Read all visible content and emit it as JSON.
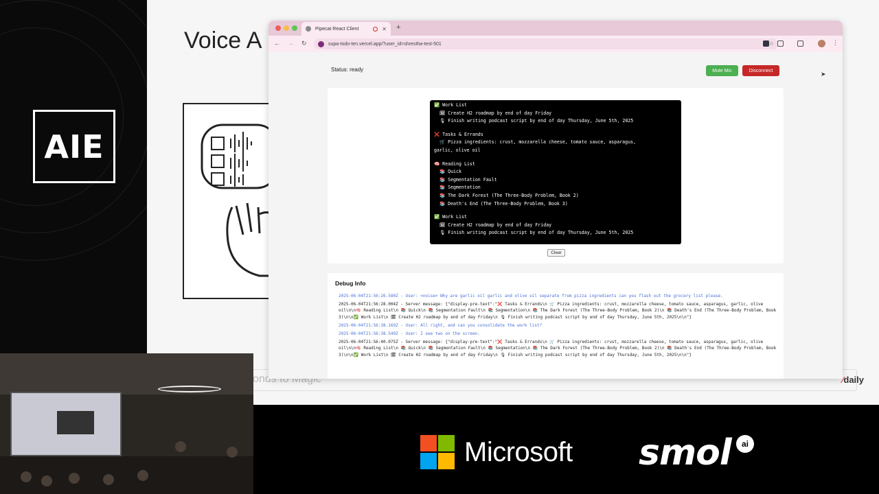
{
  "slide": {
    "title": "Voice A",
    "footer_text": "onds to Magic",
    "brand_logo": "daily"
  },
  "event_logo": "AIE",
  "browser": {
    "tab_title": "Pipecat React Client",
    "url": "supa-todo-ten.vercel.app/?user_id=shrestha-test-501"
  },
  "app": {
    "status": "Status: ready",
    "mute_label": "Mute Mic",
    "disconnect_label": "Disconnect",
    "clear_label": "Clear",
    "display_lines": [
      "✅ Work List",
      "  🗓 Create H2 roadmap by end of day Friday",
      "  🎙 Finish writing podcast script by end of day Thursday, June 5th, 2025",
      "",
      "❌ Tasks & Errands",
      "  🛒 Pizza ingredients: crust, mozzarella cheese, tomato sauce, asparagus,",
      "garlic, olive oil",
      "",
      "🧠 Reading List",
      "  📚 Quick",
      "  📚 Segmentation Fault",
      "  📚 Segmentation",
      "  📚 The Dark Forest (The Three-Body Problem, Book 2)",
      "  📚 Death's End (The Three-Body Problem, Book 3)",
      "",
      "✅ Work List",
      "  🗓 Create H2 roadmap by end of day Friday",
      "  🎙 Finish writing podcast script by end of day Thursday, June 5th, 2025"
    ],
    "debug_title": "Debug Info",
    "debug_log": [
      {
        "type": "user",
        "text": "2025-06-04T21:56:26.580Z - User: <noise> Why are garlic oil garlic and olive oil separate from pizza ingredients can you flash out the grocery list please."
      },
      {
        "type": "server",
        "text": "2025-06-04T21:56:28.004Z - Server message: {\"display-pre-text\":\"❌ Tasks & Errands\\n 🛒 Pizza ingredients: crust, mozzarella cheese, tomato sauce, asparagus, garlic, olive oil\\n\\n🧠 Reading List\\n 📚 Quick\\n 📚 Segmentation Fault\\n 📚 Segmentation\\n 📚 The Dark Forest (The Three-Body Problem, Book 2)\\n 📚 Death's End (The Three-Body Problem, Book 3)\\n\\n✅ Work List\\n 🗓 Create H2 roadmap by end of day Friday\\n 🎙 Finish writing podcast script by end of day Thursday, June 5th, 2025\\n\\n\"}"
      },
      {
        "type": "user",
        "text": "2025-06-04T21:56:38.169Z - User: All right, and can you consolidate the work list?"
      },
      {
        "type": "user",
        "text": "2025-06-04T21:56:38.549Z - User: I see two on the screen."
      },
      {
        "type": "server",
        "text": "2025-06-04T21:56:40.075Z - Server message: {\"display-pre-text\":\"❌ Tasks & Errands\\n 🛒 Pizza ingredients: crust, mozzarella cheese, tomato sauce, asparagus, garlic, olive oil\\n\\n🧠 Reading List\\n 📚 Quick\\n 📚 Segmentation Fault\\n 📚 Segmentation\\n 📚 The Dark Forest (The Three-Body Problem, Book 2)\\n 📚 Death's End (The Three-Body Problem, Book 3)\\n\\n✅ Work List\\n 🗓 Create H2 roadmap by end of day Friday\\n 🎙 Finish writing podcast script by end of day Thursday, June 5th, 2025\\n\\n\"}"
      }
    ]
  },
  "sponsors": {
    "microsoft": "Microsoft",
    "smol": "smol",
    "smol_badge": "ai"
  },
  "colors": {
    "mute": "#4caf50",
    "disconnect": "#c62828",
    "tab_bar": "#e8c9d8"
  }
}
